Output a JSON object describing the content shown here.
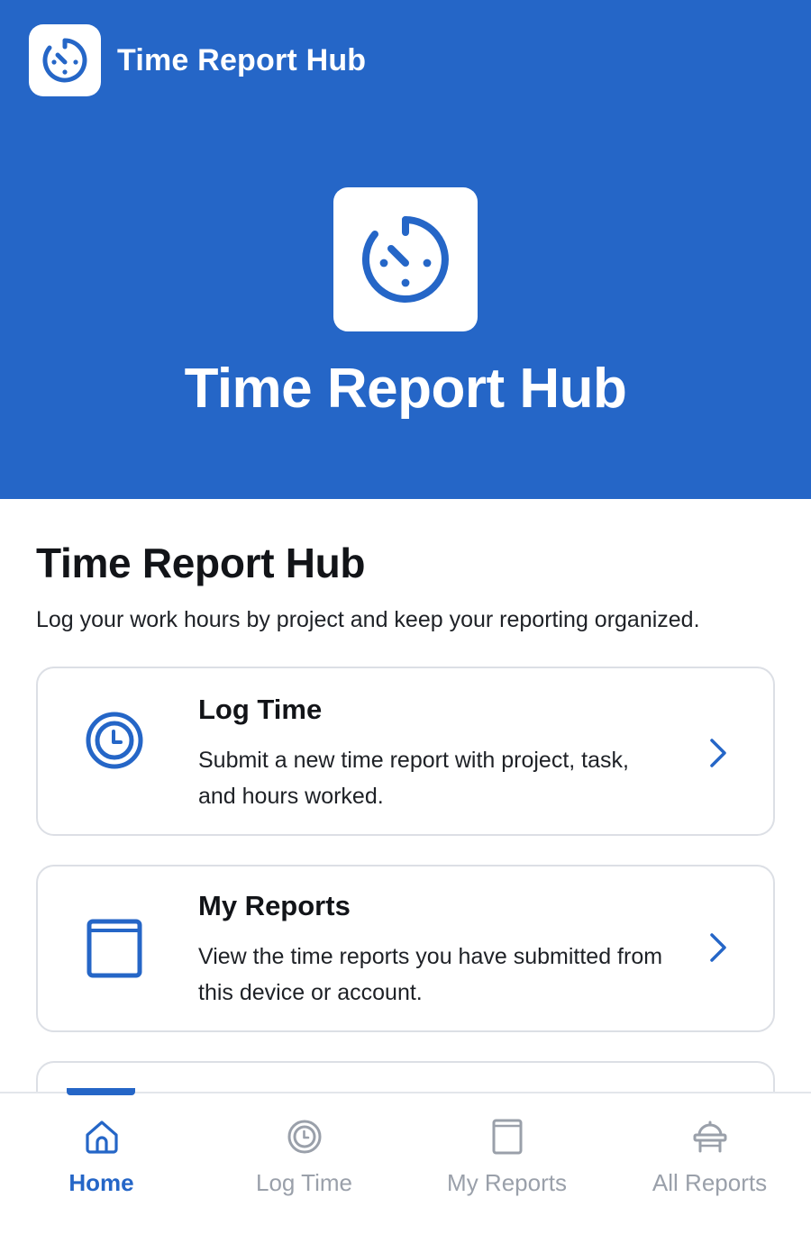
{
  "app": {
    "title": "Time Report Hub",
    "accent_color": "#2566c7",
    "logo_icon": "stopwatch-icon"
  },
  "hero": {
    "title": "Time Report Hub"
  },
  "main": {
    "title": "Time Report Hub",
    "subtitle": "Log your work hours by project and keep your reporting organized.",
    "cards": [
      {
        "icon": "clock-icon",
        "title": "Log Time",
        "description": "Submit a new time report with project, task, and hours worked."
      },
      {
        "icon": "book-icon",
        "title": "My Reports",
        "description": "View the time reports you have submitted from this device or account."
      }
    ]
  },
  "bottom_nav": {
    "items": [
      {
        "label": "Home",
        "icon": "home-icon",
        "active": true
      },
      {
        "label": "Log Time",
        "icon": "clock-icon",
        "active": false
      },
      {
        "label": "My Reports",
        "icon": "book-icon",
        "active": false
      },
      {
        "label": "All Reports",
        "icon": "desk-icon",
        "active": false
      }
    ]
  }
}
